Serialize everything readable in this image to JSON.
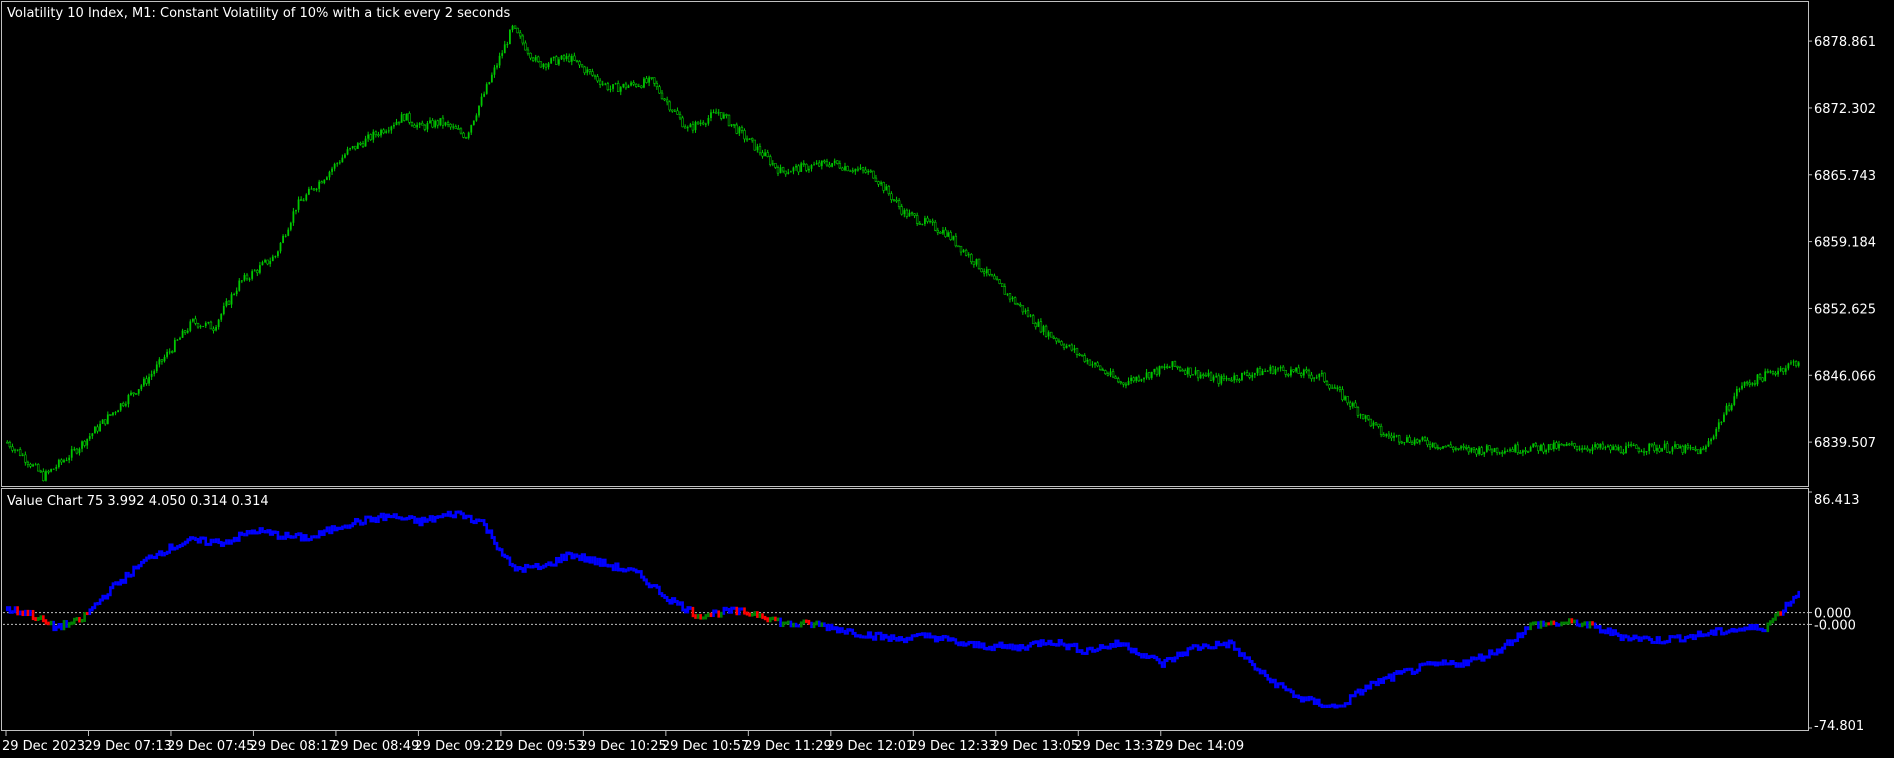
{
  "colors": {
    "background": "#000000",
    "frame": "#c0c0c0",
    "bull_candle": "#00c800",
    "bear_candle": "#00c800",
    "value_line": "#0000ff",
    "value_up": "#008000",
    "value_down": "#ff0000",
    "level_line": "#c0c0c0",
    "text": "#ffffff"
  },
  "main": {
    "title": "Volatility 10 Index, M1:  Constant Volatility of 10% with a tick every 2 seconds"
  },
  "indicator": {
    "title": "Value Chart 75 3.992 4.050 0.314 0.314"
  },
  "chart_data": [
    {
      "type": "candlestick",
      "title": "Volatility 10 Index, M1:  Constant Volatility of 10% with a tick every 2 seconds",
      "ylim": [
        6835.2,
        6882.6
      ],
      "y_ticks": [
        "6878.861",
        "6872.302",
        "6865.743",
        "6859.184",
        "6852.625",
        "6846.066",
        "6839.507"
      ],
      "x_ticks": [
        "29 Dec 2023",
        "29 Dec 07:13",
        "29 Dec 07:45",
        "29 Dec 08:17",
        "29 Dec 08:49",
        "29 Dec 09:21",
        "29 Dec 09:53",
        "29 Dec 10:25",
        "29 Dec 10:57",
        "29 Dec 11:29",
        "29 Dec 12:01",
        "29 Dec 12:33",
        "29 Dec 13:05",
        "29 Dec 13:37",
        "29 Dec 14:09"
      ],
      "key_points_x_minutes": [
        0,
        6,
        14,
        26,
        44,
        54,
        72,
        80,
        90,
        104,
        112,
        132,
        154,
        160,
        168,
        178,
        196,
        206,
        218,
        234,
        250,
        264,
        276,
        300,
        320,
        336,
        348,
        364,
        388,
        402,
        432,
        452,
        470,
        492,
        510,
        534,
        552,
        566,
        588,
        608,
        624,
        642,
        658,
        672,
        695
      ],
      "key_points_close": [
        6839.5,
        6838.2,
        6836.1,
        6838.6,
        6843.2,
        6845.6,
        6851.3,
        6850.8,
        6855.1,
        6857.8,
        6862.6,
        6868.0,
        6871.5,
        6870.4,
        6870.9,
        6869.6,
        6880.1,
        6876.6,
        6877.2,
        6874.2,
        6874.9,
        6870.2,
        6871.9,
        6866.1,
        6866.9,
        6865.8,
        6862.0,
        6860.1,
        6854.0,
        6850.5,
        6845.3,
        6847.0,
        6845.6,
        6846.7,
        6845.9,
        6840.2,
        6839.4,
        6838.7,
        6838.9,
        6839.1,
        6838.8,
        6839.0,
        6838.6,
        6844.9,
        6847.5
      ]
    },
    {
      "type": "line",
      "title": "Value Chart 75 3.992 4.050 0.314 0.314",
      "ylim": [
        -74.801,
        86.413
      ],
      "y_ticks": [
        "86.413",
        "0.000",
        "-0.000",
        "-74.801"
      ],
      "levels": [
        4.05,
        -4.05
      ],
      "key_points_x_minutes": [
        0,
        8,
        18,
        28,
        40,
        56,
        70,
        84,
        96,
        108,
        118,
        130,
        148,
        160,
        174,
        184,
        196,
        208,
        218,
        230,
        244,
        256,
        268,
        280,
        292,
        302,
        314,
        330,
        344,
        358,
        372,
        392,
        404,
        418,
        432,
        448,
        460,
        474,
        488,
        502,
        516,
        528,
        540,
        552,
        566,
        578,
        592,
        610,
        626,
        640,
        654,
        668,
        682,
        695
      ],
      "key_points_value": [
        6,
        4,
        -6,
        -2,
        20,
        43,
        53,
        52,
        60,
        56,
        55,
        64,
        70,
        66,
        72,
        66,
        34,
        35,
        44,
        38,
        31,
        14,
        2,
        5,
        3,
        -4,
        -4,
        -10,
        -14,
        -12,
        -18,
        -20,
        -15,
        -22,
        -17,
        -31,
        -20,
        -17,
        -40,
        -55,
        -61,
        -46,
        -38,
        -32,
        -30,
        -22,
        -4,
        -3,
        -12,
        -15,
        -12,
        -8,
        -6,
        18
      ]
    }
  ]
}
